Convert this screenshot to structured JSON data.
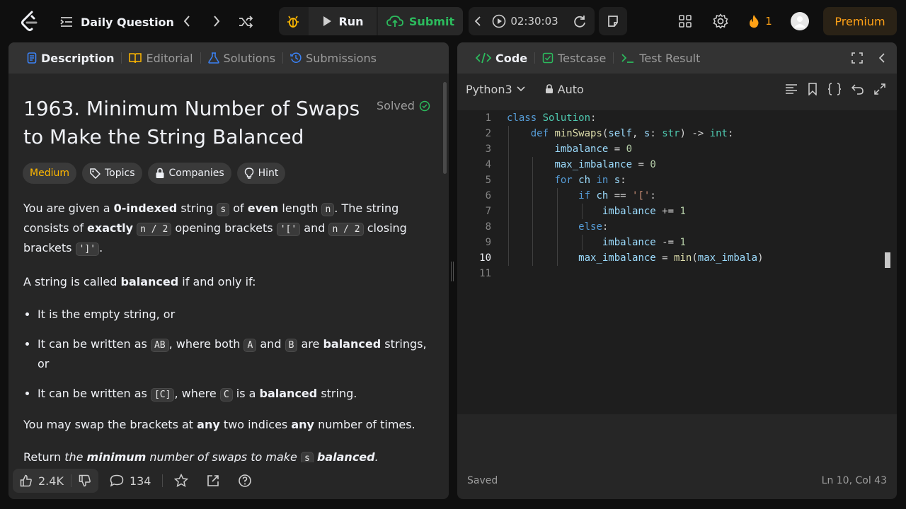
{
  "topbar": {
    "daily_question": "Daily Question",
    "run": "Run",
    "submit": "Submit",
    "timer": "02:30:03",
    "streak": "1",
    "premium": "Premium"
  },
  "left": {
    "tabs": [
      "Description",
      "Editorial",
      "Solutions",
      "Submissions"
    ],
    "title": "1963. Minimum Number of Swaps to Make the String Balanced",
    "solved": "Solved",
    "badges": {
      "difficulty": "Medium",
      "topics": "Topics",
      "companies": "Companies",
      "hint": "Hint"
    },
    "desc": {
      "p1_a": "You are given a ",
      "p1_b": "0-indexed",
      "p1_c": " string ",
      "p1_s": "s",
      "p1_d": " of ",
      "p1_e": "even",
      "p1_f": " length ",
      "p1_n": "n",
      "p1_g": ". The string consists of ",
      "p1_h": "exactly",
      "p1_code1": "n / 2",
      "p1_i": " opening brackets ",
      "p1_code2": "'['",
      "p1_j": " and ",
      "p1_code3": "n / 2",
      "p1_k": " closing brackets ",
      "p1_code4": "']'",
      "p1_l": ".",
      "p2_a": "A string is called ",
      "p2_b": "balanced",
      "p2_c": " if and only if:",
      "li1": "It is the empty string, or",
      "li2_a": "It can be written as ",
      "li2_ab": "AB",
      "li2_b": ", where both ",
      "li2_A": "A",
      "li2_c": " and ",
      "li2_B": "B",
      "li2_d": " are ",
      "li2_e": "balanced",
      "li2_f": " strings, or",
      "li3_a": "It can be written as ",
      "li3_code": "[C]",
      "li3_b": ", where ",
      "li3_C": "C",
      "li3_c": " is a ",
      "li3_d": "balanced",
      "li3_e": " string.",
      "p3_a": "You may swap the brackets at ",
      "p3_b": "any",
      "p3_c": " two indices ",
      "p3_d": "any",
      "p3_e": " number of times.",
      "p4_a": "Return ",
      "p4_b": "the ",
      "p4_c": "minimum",
      "p4_d": " number of swaps to make ",
      "p4_s": "s",
      "p4_e": " ",
      "p4_f": "balanced",
      "p4_g": "."
    },
    "footer": {
      "likes": "2.4K",
      "comments": "134"
    }
  },
  "right": {
    "tabs": [
      "Code",
      "Testcase",
      "Test Result"
    ],
    "language": "Python3",
    "auto": "Auto",
    "line_numbers": [
      "1",
      "2",
      "3",
      "4",
      "5",
      "6",
      "7",
      "8",
      "9",
      "10",
      "11"
    ],
    "code_lines": [
      "class Solution:",
      "    def minSwaps(self, s: str) -> int:",
      "        imbalance = 0",
      "        max_imbalance = 0",
      "        for ch in s:",
      "            if ch == '[':",
      "                imbalance += 1",
      "            else:",
      "                imbalance -= 1",
      "            max_imbalance = min(max_imbala)",
      ""
    ],
    "status": "Saved",
    "cursor": "Ln 10, Col 43"
  }
}
